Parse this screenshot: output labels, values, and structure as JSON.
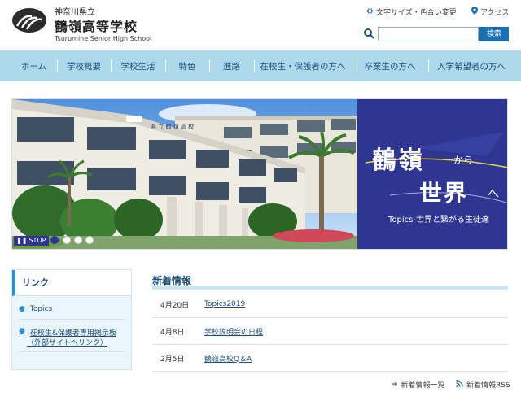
{
  "header": {
    "pref": "神奈川県立",
    "school_name": "鶴嶺高等学校",
    "school_en": "Tsurumine Senior High School",
    "util_text_size": "文字サイズ・色合い変更",
    "util_access": "アクセス",
    "search_placeholder": "",
    "search_button": "検索"
  },
  "nav": {
    "items": [
      "ホーム",
      "学校概要",
      "学校生活",
      "特色",
      "進路",
      "在校生・保護者の方へ",
      "卒業生の方へ",
      "入学希望者の方へ"
    ]
  },
  "hero": {
    "line1": "鶴嶺",
    "kara": "から",
    "line2": "世界",
    "he": "へ",
    "subtitle": "Topics-世界と繋がる生徒達",
    "stop_label": "STOP",
    "slide_count": 4,
    "active_slide": 1
  },
  "sidebar": {
    "heading": "リンク",
    "items": [
      "Topics",
      "在校生&保護者専用掲示板",
      "（外部サイトへリンク）"
    ]
  },
  "news": {
    "title": "新着情報",
    "rows": [
      {
        "date": "4月20日",
        "text": "Topics2019"
      },
      {
        "date": "4月8日",
        "text": "学校説明会の日程"
      },
      {
        "date": "2月5日",
        "text": "鶴嶺高校Q＆A"
      }
    ],
    "list_link": "新着情報一覧",
    "rss_link": "新着情報RSS"
  },
  "colors": {
    "accent": "#1a6fb3",
    "nav_bg": "#aed8ec",
    "hero_panel": "#2e3692"
  }
}
